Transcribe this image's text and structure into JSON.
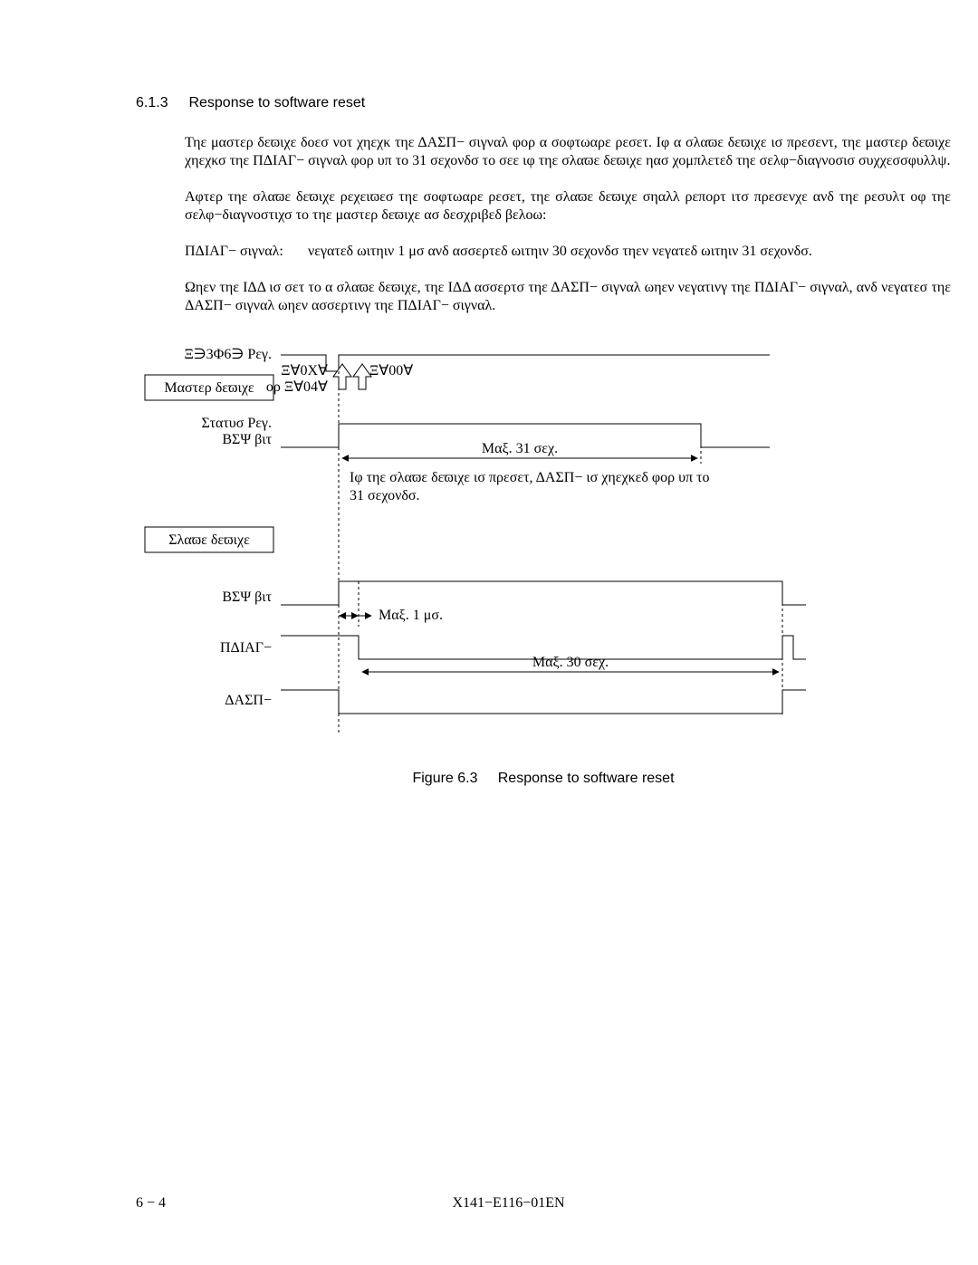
{
  "section": {
    "number": "6.1.3",
    "title": "Response to software reset"
  },
  "paragraphs": {
    "p1": "Τηε μαστερ δεϖιχε δοεσ νοτ χηεχκ τηε ΔΑΣΠ− σιγναλ φορ α σοφτωαρε ρεσετ.  Ιφ α σλαϖε δεϖιχε ισ πρεσεντ, τηε μαστερ δεϖιχε χηεχκσ τηε ΠΔΙΑΓ− σιγναλ φορ υπ το 31 σεχονδσ το σεε ιφ τηε σλαϖε δεϖιχε ηασ χομπλετεδ τηε σελφ−διαγνοσισ συχχεσσφυλλψ.",
    "p2": "Αφτερ τηε σλαϖε δεϖιχε ρεχειϖεσ τηε σοφτωαρε ρεσετ, τηε σλαϖε δεϖιχε σηαλλ ρεπορτ ιτσ πρεσενχε ανδ τηε ρεσυλτ οφ τηε σελφ−διαγνοστιχσ το τηε μαστερ δεϖιχε ασ δεσχριβεδ βελοω:",
    "signal_label": "ΠΔΙΑΓ− σιγναλ:",
    "signal_desc": "νεγατεδ ωιτηιν 1 μσ ανδ ασσερτεδ ωιτηιν 30 σεχονδσ τηεν νεγατεδ ωιτηιν 31 σεχονδσ.",
    "p3": "Ωηεν τηε ΙΔΔ ισ σετ το α σλαϖε δεϖιχε, τηε ΙΔΔ ασσερτσ τηε ΔΑΣΠ− σιγναλ ωηεν νεγατινγ τηε ΠΔΙΑΓ− σιγναλ, ανδ νεγατεσ τηε ΔΑΣΠ− σιγναλ ωηεν ασσερτινγ τηε ΠΔΙΑΓ− σιγναλ."
  },
  "chart_data": {
    "type": "timing-diagram",
    "signals": [
      {
        "section": "master",
        "name": "Ξ∋3Φ6∋ Ρεγ.",
        "box": false,
        "has_write_pulse": true
      },
      {
        "section": "master",
        "name": "Μαστερ δεϖιχε",
        "box": true
      },
      {
        "section": "master",
        "name": "Στατυσ Ρεγ.",
        "box": false,
        "subname": "ΒΣΨ βιτ",
        "high_segment": "until_max_31s"
      },
      {
        "section": "slave",
        "name": "Σλαϖε δεϖιχε",
        "box": true
      },
      {
        "section": "slave",
        "name": "ΒΣΨ βιτ",
        "high_segment": "until_end"
      },
      {
        "section": "slave",
        "name": "ΠΔΙΑΓ−",
        "low_then_high_pulse_at_end": true
      },
      {
        "section": "slave",
        "name": "ΔΑΣΠ−",
        "low_segment": "until_end"
      }
    ],
    "write_labels": {
      "left": "Ξ∀0Χ∀",
      "left_sub": "ορ Ξ∀04∀",
      "right": "Ξ∀00∀"
    },
    "annotations": [
      {
        "text": "Μαξ. 31 σεχ.",
        "double_arrow": true,
        "from": "write",
        "to": "end_31"
      },
      {
        "text": "Ιφ τηε σλαϖε δεϖιχε ισ πρεσετ, ΔΑΣΠ− ισ χηεχκεδ φορ υπ το 31 σεχονδσ.",
        "plain": true
      },
      {
        "text": "Μαξ. 1 μσ.",
        "double_arrow": true,
        "span": "short"
      },
      {
        "text": "Μαξ. 30 σεχ.",
        "double_arrow": true,
        "span": "long"
      }
    ]
  },
  "labels": {
    "row1": "Ξ∋3Φ6∋ Ρεγ.",
    "master_box": "Μαστερ δεϖιχε",
    "status_reg": "Στατυσ Ρεγ.",
    "bsy_bit_master": "ΒΣΨ βιτ",
    "slave_box": "Σλαϖε δεϖιχε",
    "bsy_bit_slave": "ΒΣΨ βιτ",
    "pdiag": "ΠΔΙΑΓ−",
    "dasp": "ΔΑΣΠ−",
    "write_left": "Ξ∀0Χ∀",
    "write_left_sub": "ορ Ξ∀04∀",
    "write_right": "Ξ∀00∀",
    "max31": "Μαξ. 31 σεχ.",
    "check_note_l1": "Ιφ τηε σλαϖε δεϖιχε ισ πρεσετ, ΔΑΣΠ− ισ χηεχκεδ φορ υπ το",
    "check_note_l2": "31 σεχονδσ.",
    "max1ms": "Μαξ. 1 μσ.",
    "max30": "Μαξ. 30 σεχ."
  },
  "figure": {
    "number": "Figure 6.3",
    "title": "Response to software reset"
  },
  "footer": {
    "page": "6 − 4",
    "doc": "X141−E116−01EN"
  }
}
